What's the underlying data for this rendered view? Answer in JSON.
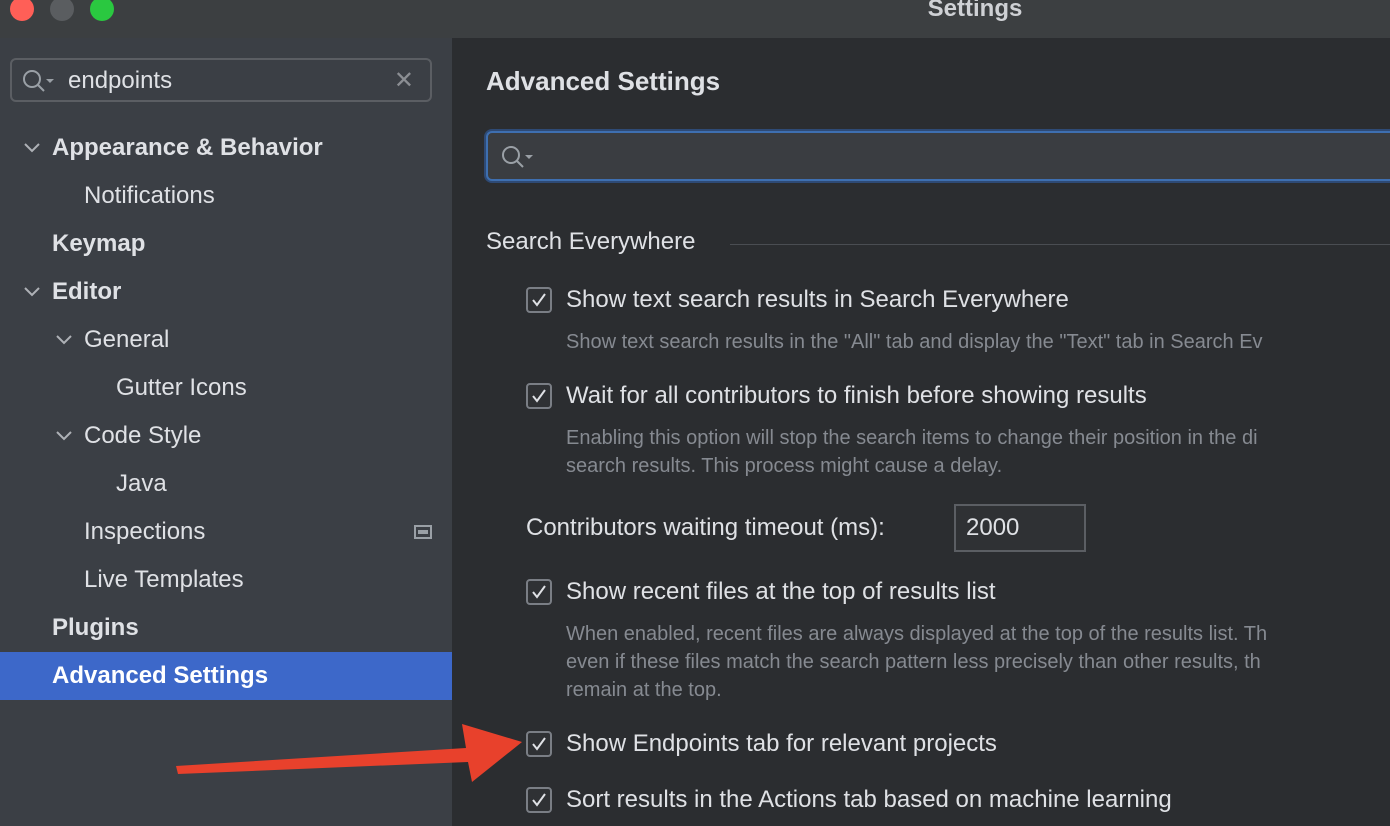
{
  "window": {
    "title": "Settings"
  },
  "sidebar": {
    "search": {
      "value": "endpoints",
      "placeholder": ""
    },
    "items": [
      {
        "label": "Appearance & Behavior",
        "level": 0,
        "bold": true,
        "expanded": true
      },
      {
        "label": "Notifications",
        "level": 1
      },
      {
        "label": "Keymap",
        "level": 0,
        "bold": true
      },
      {
        "label": "Editor",
        "level": 0,
        "bold": true,
        "expanded": true
      },
      {
        "label": "General",
        "level": 1,
        "expanded": true
      },
      {
        "label": "Gutter Icons",
        "level": 2
      },
      {
        "label": "Code Style",
        "level": 1,
        "expanded": true
      },
      {
        "label": "Java",
        "level": 2
      },
      {
        "label": "Inspections",
        "level": 1
      },
      {
        "label": "Live Templates",
        "level": 1
      },
      {
        "label": "Plugins",
        "level": 0,
        "bold": true
      },
      {
        "label": "Advanced Settings",
        "level": 0,
        "bold": true,
        "selected": true
      }
    ]
  },
  "main": {
    "title": "Advanced Settings",
    "search": {
      "value": "",
      "placeholder": ""
    },
    "group": "Search Everywhere",
    "options": [
      {
        "label": "Show text search results in Search Everywhere",
        "checked": true,
        "description": "Show text search results in the \"All\" tab and display the \"Text\" tab in Search Ev"
      },
      {
        "label": "Wait for all contributors to finish before showing results",
        "checked": true,
        "description_lines": [
          "Enabling this option will stop the search items to change their position in the di",
          "search results. This process might cause a delay."
        ]
      },
      {
        "label": "Show recent files at the top of results list",
        "checked": true,
        "description_lines": [
          "When enabled, recent files are always displayed at the top of the results list. Th",
          "even if these files match the search pattern less precisely than other results, th",
          "remain at the top."
        ]
      },
      {
        "label": "Show Endpoints tab for relevant projects",
        "checked": true
      },
      {
        "label": "Sort results in the Actions tab based on machine learning",
        "checked": true
      }
    ],
    "timeout": {
      "label": "Contributors waiting timeout (ms):",
      "value": "2000"
    }
  },
  "colors": {
    "selection": "#3d68c9",
    "arrow": "#e8412c"
  }
}
